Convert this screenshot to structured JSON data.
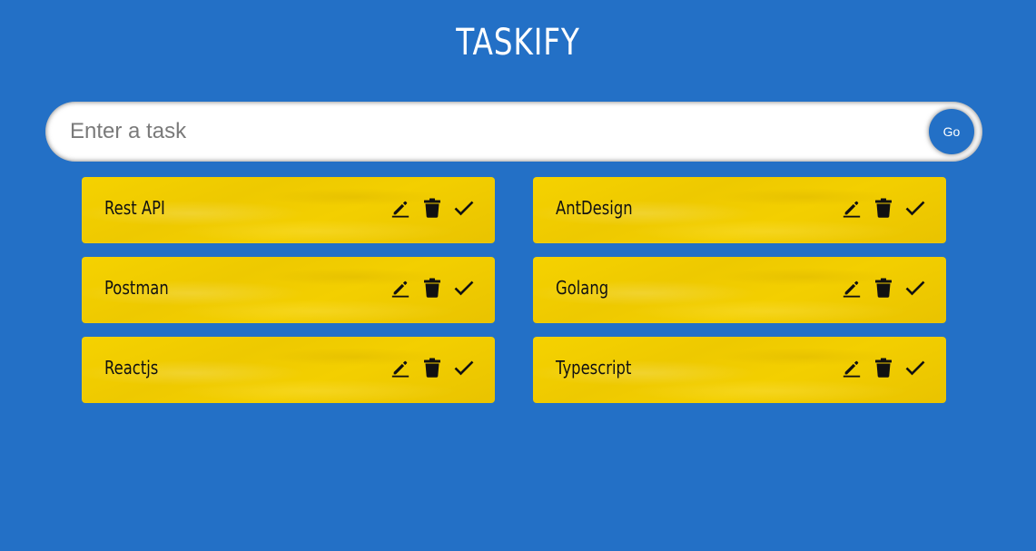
{
  "app": {
    "title": "TASKIFY"
  },
  "input": {
    "placeholder": "Enter a task",
    "value": "",
    "submit_label": "Go"
  },
  "colors": {
    "background": "#2370c6",
    "card": "#f3cf00",
    "button": "#2370c6"
  },
  "todos": {
    "left": [
      {
        "text": "Rest API"
      },
      {
        "text": "Postman"
      },
      {
        "text": "Reactjs"
      }
    ],
    "right": [
      {
        "text": "AntDesign"
      },
      {
        "text": "Golang"
      },
      {
        "text": "Typescript"
      }
    ]
  },
  "icons": {
    "edit": "edit-icon",
    "delete": "delete-icon",
    "done": "check-icon"
  }
}
